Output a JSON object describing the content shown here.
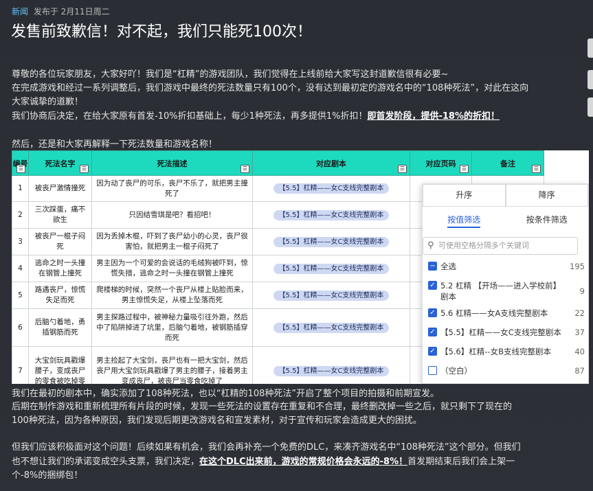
{
  "header": {
    "tag": "新闻",
    "meta": "发布于 2月11日周二",
    "title": "发售前致歉信！对不起，我们只能死100次！"
  },
  "intro": {
    "line1": "尊敬的各位玩家朋友，大家好吖！我们是“杠精”的游戏团队，我们觉得在上线前给大家写这封道歉信很有必要~",
    "line2": "在完成游戏和经过一系列调整后，我们游戏中最终的死法数量只有100个，没有达到最初定的游戏名中的“108种死法”，对此在这向",
    "line3": "大家诚挚的道歉！",
    "line4_a": "我们协商后决定，在给大家原有首发-10%折扣基础上，每少1种死法，再多提供1%折扣！",
    "line4_b": "即首发阶段，提供-18%的折扣！",
    "line5": "然后，还是和大家再解释一下死法数量和游戏名称！"
  },
  "sheet": {
    "headers": [
      "编号",
      "死法名字",
      "死法描述",
      "对应剧本",
      "对应页码",
      "备注"
    ],
    "rows": [
      {
        "id": "1",
        "name": "被丧尸激情撞死",
        "desc": "因为动了丧尸的可乐，丧尸不乐了，就把男主撞死了",
        "script": "【5.5】杠精——女C支线完整剧本"
      },
      {
        "id": "2",
        "name": "三次踩蛋，痛不欲生",
        "desc": "只因结雪琪是吧？看招吧！",
        "script": "【5.5】杠精——女C支线完整剧本"
      },
      {
        "id": "3",
        "name": "被丧尸一棍子闷死",
        "desc": "因为丢掉木棍，吓到了丧尸幼小的心灵，丧尸很害怕，就把男主一棍子闷死了",
        "script": "【5.5】杠精——女C支线完整剧本"
      },
      {
        "id": "4",
        "name": "逃命之时一头撞在钢管上撞死",
        "desc": "男主因为一个可爱的会说话的毛绒狗被吓到，惊慌失措，逃命之时一头撞在钢管上撞死",
        "script": "【5.5】杠精——女C支线完整剧本"
      },
      {
        "id": "5",
        "name": "路遇丧尸，惊慌失足而死",
        "desc": "爬楼梯的时候，突然一个丧尸从楼上贴脸而来，男主惊慌失足，从楼上坠落而死",
        "script": "【5.5】杠精——女C支线完整剧本"
      },
      {
        "id": "6",
        "name": "后脑勺着地，勇插钢筋而死",
        "desc": "男主探路过程中，被神秘力量吸引往外跑，然后中了陷阱掉进了坑里，后脑勺着地，被钢筋插穿而死",
        "script": "【5.5】杠精——女C支线完整剧本"
      },
      {
        "id": "7",
        "name": "大宝剑玩具戳爆腰子，变成丧尸的零食被吃掉零",
        "desc": "男主捡起了大宝剑，丧尸也有一把大宝剑，然后丧尸用大宝剑玩具戳爆了男主的腰子，接着男主变成丧尸，被丧尸当零食吃掉了",
        "script": "【5.5】杠精——女C支线完整剧本"
      }
    ]
  },
  "filter_panel": {
    "sort_asc": "升序",
    "sort_desc": "降序",
    "tab_values": "按值筛选",
    "tab_conditions": "按条件筛选",
    "search_placeholder": "可使用空格分隔多个关键词",
    "options": [
      {
        "label": "全选",
        "count": "195",
        "state": "partial"
      },
      {
        "label": "5.2 杠精 【开场——进入学校前】剧本",
        "count": "9",
        "state": "checked"
      },
      {
        "label": "5.6 杠精——女A支线完整剧本",
        "count": "22",
        "state": "checked"
      },
      {
        "label": "【5.5】杠精——女C支线完整剧本",
        "count": "37",
        "state": "checked"
      },
      {
        "label": "【5.6】杠精--女B支线完整剧本",
        "count": "40",
        "state": "checked"
      },
      {
        "label": "（空白）",
        "count": "87",
        "state": "unchecked"
      }
    ]
  },
  "outro": {
    "line1": "我们在最初的剧本中，确实添加了108种死法，也以“杠精的108种死法”开启了整个项目的拍摄和前期宣发。",
    "line2": "后期在制作游戏和重新梳理所有片段的时候，发现一些死法的设置存在重复和不合理，最终删改掉一些之后，就只剩下了现在的",
    "line3": "100种死法，因为各种原因，我们发现后期更改游戏名和宣发素材，对于宣传和玩家会造成更大的困扰。",
    "line4": "但我们应该积极面对这个问题！后续如果有机会，我们会再补充一个免费的DLC，来凑齐游戏名中“108种死法”这个部分。但我们",
    "line5_a": "也不想让我们的承诺变成空头支票，我们决定，",
    "line5_b": "在这个DLC出来前，游戏的常规价格会永远的-8%！",
    "line5_c": "首发期结束后我们会上架一",
    "line6": "个-8%的捆绑包！"
  }
}
